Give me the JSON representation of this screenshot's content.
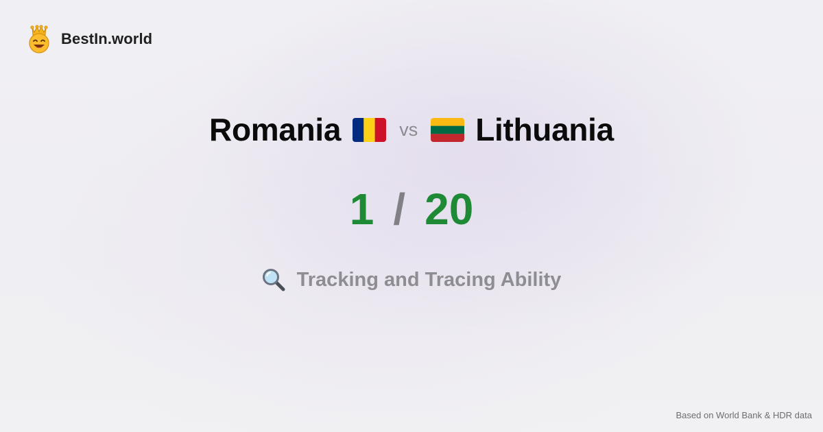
{
  "brand": {
    "name": "BestIn.world",
    "logo_icon": "crown-smiley-icon"
  },
  "comparison": {
    "left_country": "Romania",
    "left_flag": "romania-flag-icon",
    "vs_label": "vs",
    "right_country": "Lithuania",
    "right_flag": "lithuania-flag-icon"
  },
  "scores": {
    "left_rank": "1",
    "separator": "/",
    "right_rank": "20"
  },
  "metric": {
    "icon": "magnifier-icon",
    "label": "Tracking and Tracing Ability"
  },
  "footer": {
    "source": "Based on World Bank & HDR data"
  },
  "colors": {
    "rank_green": "#1f8a36",
    "muted_gray": "#8e8e92",
    "romania_blue": "#002b7f",
    "romania_yellow": "#fcd116",
    "romania_red": "#ce1126",
    "lithuania_yellow": "#fdb913",
    "lithuania_green": "#006a44",
    "lithuania_red": "#c1272d"
  }
}
